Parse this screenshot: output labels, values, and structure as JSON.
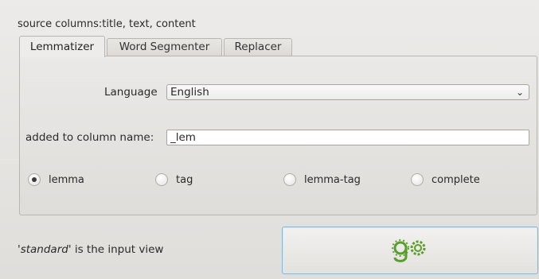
{
  "source_columns": "source columns:title, text, content",
  "tabs": [
    {
      "label": "Lemmatizer",
      "active": true
    },
    {
      "label": "Word Segmenter",
      "active": false
    },
    {
      "label": "Replacer",
      "active": false
    }
  ],
  "language": {
    "label": "Language",
    "selected": "English"
  },
  "column_suffix": {
    "label": "added to column name:",
    "value": "_lem"
  },
  "modes": [
    {
      "label": "lemma",
      "checked": true
    },
    {
      "label": "tag",
      "checked": false
    },
    {
      "label": "lemma-tag",
      "checked": false
    },
    {
      "label": "complete",
      "checked": false
    }
  ],
  "status": {
    "view_name": "'standard'",
    "text": " is the input view"
  },
  "go_button": {
    "icon": "go-gears-icon",
    "color": "#5a9e2a"
  }
}
